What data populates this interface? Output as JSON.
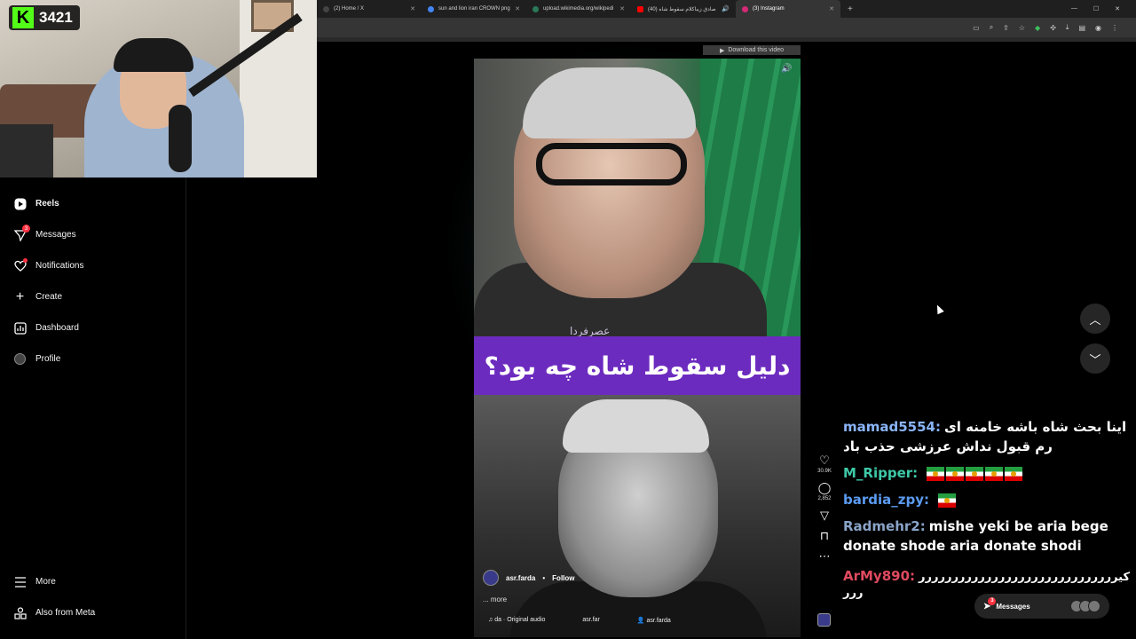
{
  "stream": {
    "kick_viewers": "3421"
  },
  "browser": {
    "tabs": [
      {
        "label": "(2) Home / X",
        "color": "#444444"
      },
      {
        "label": "sun and lion iran CROWN png",
        "color": "#4285f4"
      },
      {
        "label": "upload.wikimedia.org/wikipedi",
        "color": "#2a7a5a"
      },
      {
        "label": "(40) صادق زیباکلام سقوط شاه",
        "color": "#ff0000"
      },
      {
        "label": "(3) Instagram",
        "color": "#d62976"
      }
    ],
    "new_tab": "+"
  },
  "sidebar": {
    "items": [
      {
        "label": "Reels",
        "badge": ""
      },
      {
        "label": "Messages",
        "badge": "3"
      },
      {
        "label": "Notifications",
        "badge": ""
      },
      {
        "label": "Create",
        "badge": ""
      },
      {
        "label": "Dashboard",
        "badge": ""
      },
      {
        "label": "Profile",
        "badge": ""
      }
    ],
    "more": "More",
    "also_from_meta": "Also from Meta"
  },
  "reel": {
    "download_label": "Download this video",
    "caption_overlay": "دلیل سقوط شاه چه بود؟",
    "watermark": "عصرفردا",
    "author": "asr.farda",
    "follow": "Follow",
    "more": "... more",
    "audio": "da · Original audio",
    "audio_user": "asr.far",
    "tagged_user": "asr.farda",
    "likes": "30.9K",
    "comments": "2,852"
  },
  "chat": {
    "messages": [
      {
        "user": "mamad5554:",
        "color": "#8ab4f8",
        "text": "اینا بحث شاه باشه خامنه ای رم قبول نداش عرزشی حذب باد",
        "flags": 0
      },
      {
        "user": "M_Ripper:",
        "color": "#3ec9a7",
        "text": "",
        "flags": 5
      },
      {
        "user": "bardia_zpy:",
        "color": "#5b9bf0",
        "text": "",
        "flags": 1
      },
      {
        "user": "Radmehr2:",
        "color": "#8aa4c8",
        "text": "mishe yeki be aria bege donate shode aria donate shodi",
        "flags": 0
      },
      {
        "user": "ArMy890:",
        "color": "#e04a5f",
        "text": "کیررررررررررررررررررررررررررررررررر",
        "flags": 0
      }
    ]
  },
  "messages_pill": {
    "label": "Messages",
    "badge": "3"
  }
}
